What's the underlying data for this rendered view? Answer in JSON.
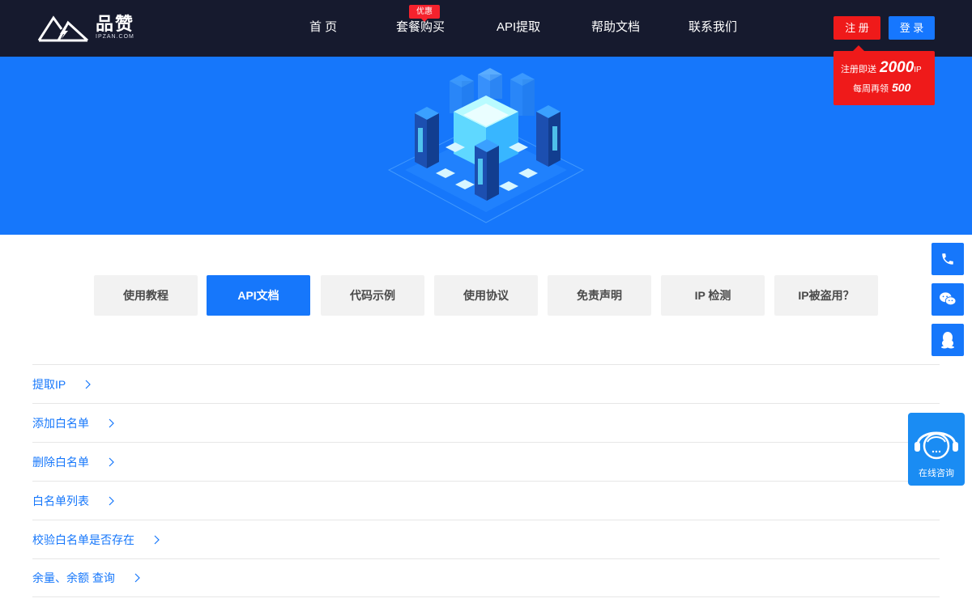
{
  "header": {
    "logo": {
      "name": "品赞",
      "domain": "IPZAN.COM"
    },
    "nav": [
      {
        "label": "首 页"
      },
      {
        "label": "套餐购买",
        "badge": "优惠"
      },
      {
        "label": "API提取"
      },
      {
        "label": "帮助文档"
      },
      {
        "label": "联系我们"
      }
    ],
    "register_label": "注 册",
    "login_label": "登 录",
    "promo": {
      "line1_prefix": "注册即送",
      "line1_amount": "2000",
      "line1_unit": "IP",
      "line2_prefix": "每周再领",
      "line2_amount": "500"
    }
  },
  "tabs": [
    {
      "label": "使用教程",
      "active": false
    },
    {
      "label": "API文档",
      "active": true
    },
    {
      "label": "代码示例",
      "active": false
    },
    {
      "label": "使用协议",
      "active": false
    },
    {
      "label": "免责声明",
      "active": false
    },
    {
      "label": "IP 检测",
      "active": false
    },
    {
      "label": "IP被盗用？",
      "active": false
    }
  ],
  "api_list": [
    {
      "label": "提取IP"
    },
    {
      "label": "添加白名单"
    },
    {
      "label": "删除白名单"
    },
    {
      "label": "白名单列表"
    },
    {
      "label": "校验白名单是否存在"
    },
    {
      "label": "余量、余额 查询"
    }
  ],
  "sidebar": {
    "icons": [
      "phone-icon",
      "wechat-icon",
      "qq-icon"
    ],
    "consult_label": "在线咨询"
  },
  "colors": {
    "header_bg": "#161a2e",
    "primary": "#1677fb",
    "register": "#ef1a1a",
    "tab_bg": "#f2f2f2"
  }
}
